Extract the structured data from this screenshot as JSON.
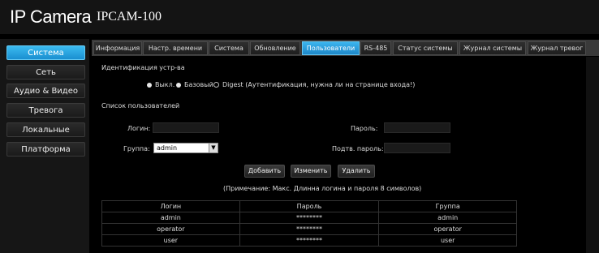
{
  "header": {
    "brand": "IP Camera",
    "model": "IPCAM-100"
  },
  "sidebar": {
    "items": [
      {
        "label": "Система",
        "active": true
      },
      {
        "label": "Сеть"
      },
      {
        "label": "Аудио & Видео"
      },
      {
        "label": "Тревога"
      },
      {
        "label": "Локальные"
      },
      {
        "label": "Платформа"
      }
    ]
  },
  "tabs": [
    {
      "label": "Информация"
    },
    {
      "label": "Настр. времени"
    },
    {
      "label": "Система"
    },
    {
      "label": "Обновление"
    },
    {
      "label": "Пользователи",
      "active": true
    },
    {
      "label": "RS-485"
    },
    {
      "label": "Статус системы"
    },
    {
      "label": "Журнал системы"
    },
    {
      "label": "Журнал тревог"
    }
  ],
  "auth": {
    "section_title": "Идентификация устр-ва",
    "options": [
      {
        "label": "Выкл.",
        "selected": false
      },
      {
        "label": "Базовый",
        "selected": false
      },
      {
        "label": "Digest (Аутентификация, нужна ли на странице входа!)",
        "selected": true
      }
    ]
  },
  "users": {
    "section_title": "Список пользователей",
    "login_label": "Логин:",
    "login_value": "",
    "password_label": "Пароль:",
    "password_value": "",
    "group_label": "Группа:",
    "group_value": "admin",
    "confirm_label": "Подтв. пароль:",
    "confirm_value": "",
    "buttons": {
      "add": "Добавить",
      "edit": "Изменить",
      "delete": "Удалить"
    },
    "note": "(Примечание: Макс. Длинна логина и пароля 8 символов)",
    "table": {
      "headers": [
        "Логин",
        "Пароль",
        "Группа"
      ],
      "rows": [
        [
          "admin",
          "********",
          "admin"
        ],
        [
          "operator",
          "********",
          "operator"
        ],
        [
          "user",
          "********",
          "user"
        ]
      ]
    }
  }
}
